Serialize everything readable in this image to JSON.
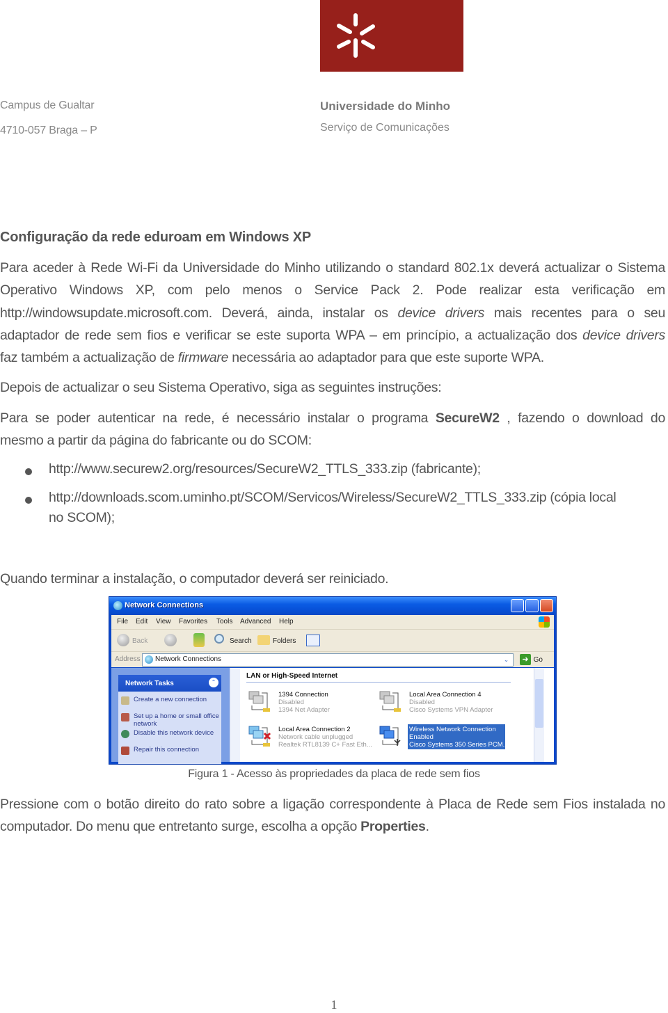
{
  "header": {
    "address_line1": "Campus de Gualtar",
    "address_line2": "4710-057 Braga – P",
    "university": "Universidade do Minho",
    "service": "Serviço de Comunicações",
    "logo_color": "#97201b"
  },
  "document": {
    "title": "Configuração da rede eduroam em Windows XP",
    "para1_lines": [
      [
        "Para aceder à Rede Wi-Fi da Universidade do Minho utilizando o standard 802.1x deverá actualizar o Sistema"
      ],
      [
        "Operativo Windows XP, com pelo menos o Service Pack 2. Pode realizar esta verificação em"
      ]
    ],
    "para1": {
      "l1": "Para aceder à Rede Wi-Fi da Universidade do Minho utilizando o standard 802.1x deverá actualizar o Sistema",
      "l2": "Operativo Windows XP, com pelo menos o Service Pack 2. Pode realizar esta verificação em",
      "l3a": "http://windowsupdate.microsoft.com. Deverá, ainda, instalar os ",
      "l3i": "device drivers",
      "l3b": " mais recentes para o seu",
      "l4a": "adaptador de rede sem fios e verificar se este suporta WPA – em princípio, a actualização dos ",
      "l4i": "device drivers",
      "l5a": "faz também a actualização de ",
      "l5i": "firmware",
      "l5b": " necessária ao adaptador para que este suporte WPA."
    },
    "para2": "Depois de actualizar o seu Sistema Operativo, siga as seguintes instruções:",
    "para3": {
      "l1a": "Para se poder autenticar na rede, é necessário instalar o programa ",
      "l1b": "SecureW2",
      "l1c": " , fazendo o download do",
      "l2": "mesmo a partir da página do fabricante ou do SCOM:"
    },
    "bullets": [
      {
        "line1": "http://www.securew2.org/resources/SecureW2_TTLS_333.zip (fabricante);"
      },
      {
        "line1": "http://downloads.scom.uminho.pt/SCOM/Servicos/Wireless/SecureW2_TTLS_333.zip (cópia local",
        "line2": "no SCOM);"
      }
    ],
    "para4": "Quando terminar a instalação, o computador deverá ser reiniciado.",
    "caption": "Figura 1 - Acesso às propriedades da placa de rede sem fios",
    "para5": {
      "l1": "Pressione com o botão direito do rato sobre a ligação correspondente à Placa de Rede sem Fios instalada no",
      "l2a": "computador. Do menu que entretanto surge, escolha a opção ",
      "l2b": "Properties",
      "l2c": "."
    },
    "page_number": "1"
  },
  "screenshot": {
    "window_title": "Network Connections",
    "menu": [
      "File",
      "Edit",
      "View",
      "Favorites",
      "Tools",
      "Advanced",
      "Help"
    ],
    "toolbar": {
      "back": "Back",
      "search": "Search",
      "folders": "Folders"
    },
    "address": {
      "label": "Address",
      "value": "Network Connections",
      "go": "Go"
    },
    "tasks_panel": {
      "title": "Network Tasks",
      "items": [
        "Create a new connection",
        "Set up a home or small office network",
        "Disable this network device",
        "Repair this connection"
      ]
    },
    "group_title": "LAN or High-Speed Internet",
    "connections": [
      {
        "name": "1394 Connection",
        "status": "Disabled",
        "device": "1394 Net Adapter"
      },
      {
        "name": "Local Area Connection 4",
        "status": "Disabled",
        "device": "Cisco Systems VPN Adapter"
      },
      {
        "name": "Local Area Connection 2",
        "status": "Network cable unplugged",
        "device": "Realtek RTL8139 C+ Fast Eth..."
      },
      {
        "name": "Wireless Network Connection",
        "status": "Enabled",
        "device": "Cisco Systems 350 Series PCM...",
        "selected": true
      }
    ],
    "selection_color": "#316ac5"
  }
}
